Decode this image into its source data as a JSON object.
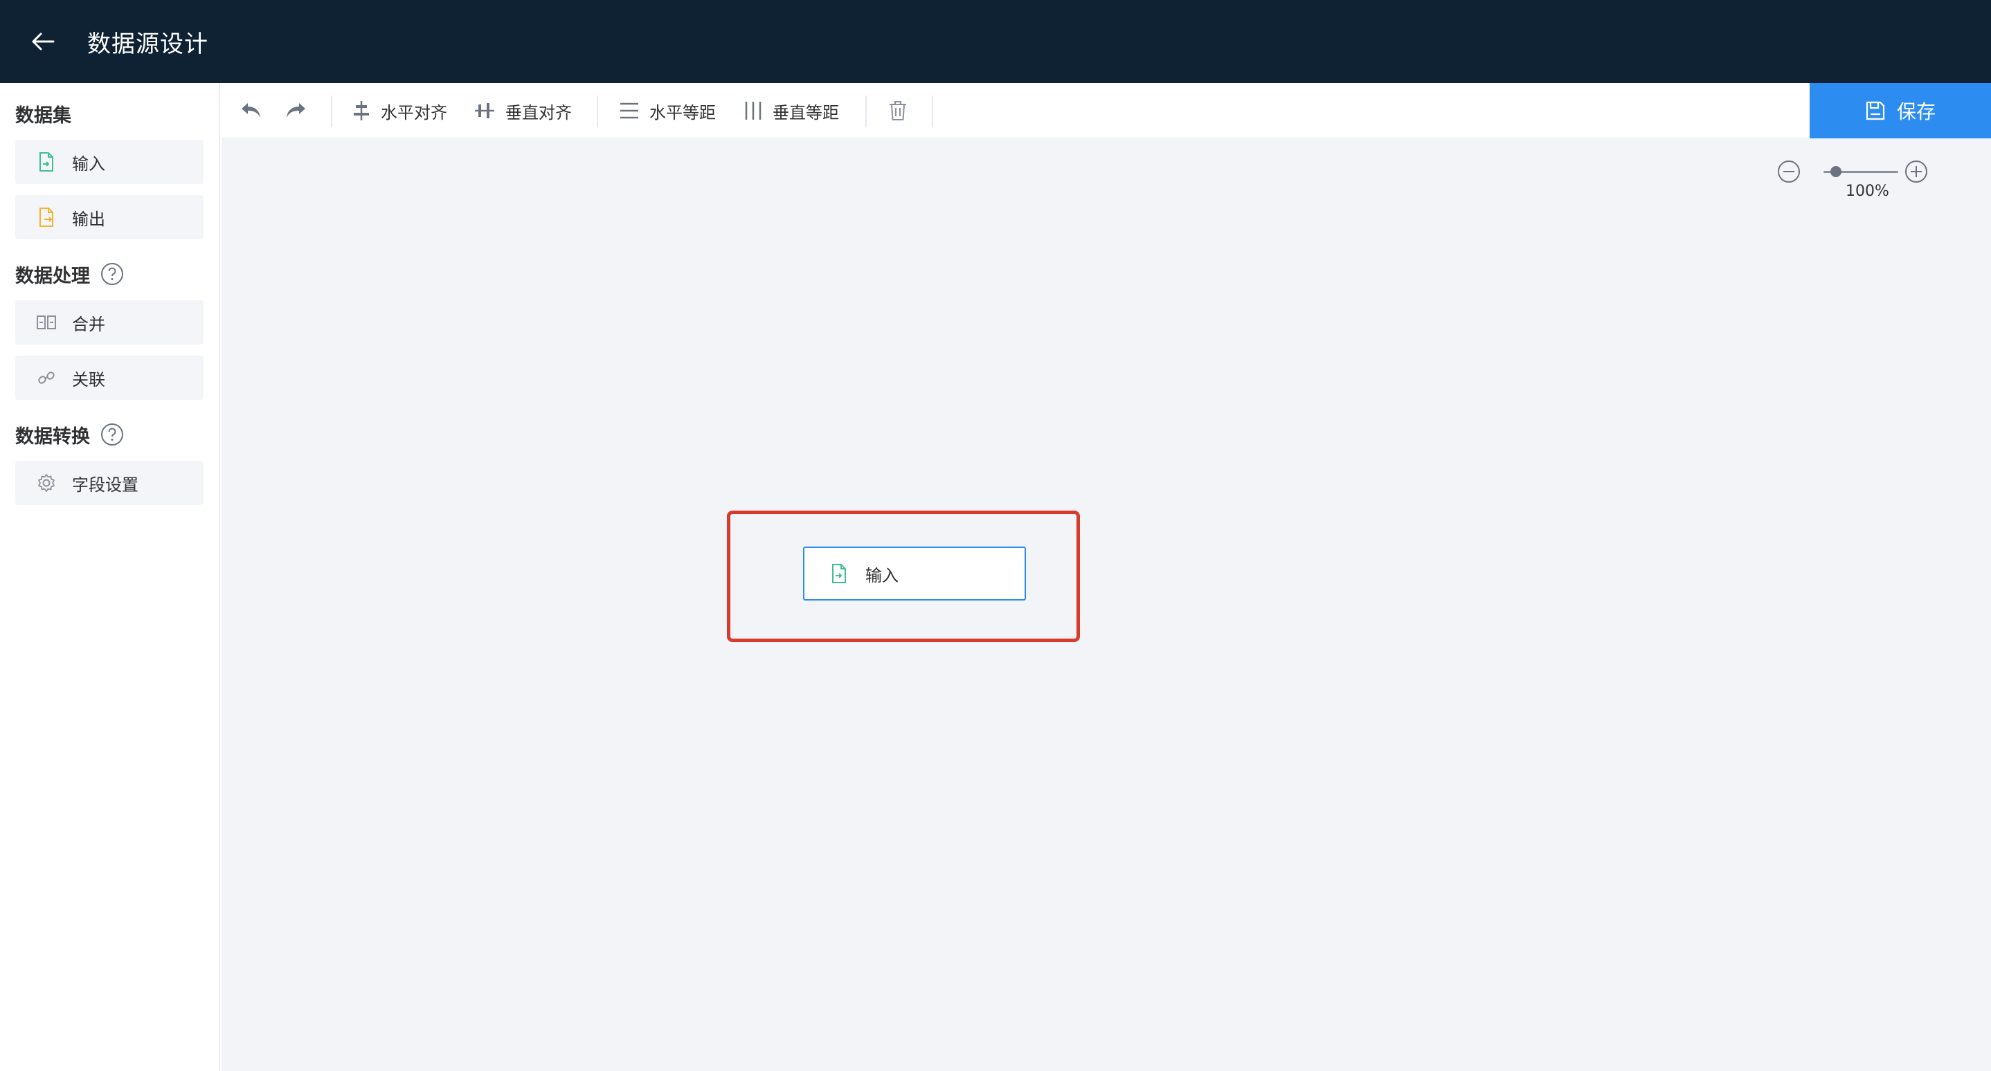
{
  "header": {
    "title": "数据源设计"
  },
  "sidebar": {
    "sections": [
      {
        "title": "数据集"
      },
      {
        "title": "数据处理"
      },
      {
        "title": "数据转换"
      }
    ],
    "items": [
      {
        "label": "输入",
        "icon": "file-import-icon",
        "color": "#3fbf8f"
      },
      {
        "label": "输出",
        "icon": "file-export-icon",
        "color": "#f5b32b"
      },
      {
        "label": "合并",
        "icon": "merge-icon",
        "color": "#8a8f99"
      },
      {
        "label": "关联",
        "icon": "link-icon",
        "color": "#8a8f99"
      },
      {
        "label": "字段设置",
        "icon": "gear-icon",
        "color": "#8a8f99"
      }
    ]
  },
  "toolbar": {
    "undo_icon": "undo-icon",
    "redo_icon": "redo-icon",
    "h_align": "水平对齐",
    "v_align": "垂直对齐",
    "h_distribute": "水平等距",
    "v_distribute": "垂直等距",
    "delete_icon": "trash-icon",
    "save": "保存"
  },
  "canvas": {
    "zoom": "100%",
    "node": {
      "label": "输入",
      "icon": "file-import-icon"
    }
  },
  "colors": {
    "header_bg": "#0e2233",
    "primary": "#2d8cf0",
    "highlight": "#d93a2e",
    "canvas_bg": "#f3f4f8"
  }
}
